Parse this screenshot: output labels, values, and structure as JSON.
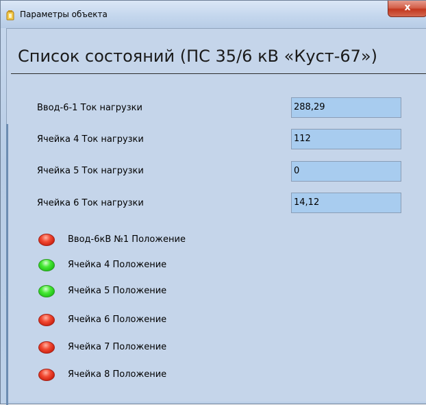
{
  "window": {
    "title": "Параметры объекта",
    "close_label": "x"
  },
  "header": {
    "title": "Список состояний (ПС 35/6 кВ «Куст-67»)"
  },
  "parameters": [
    {
      "label": "Ввод-6-1 Ток нагрузки",
      "value": "288,29"
    },
    {
      "label": "Ячейка 4 Ток нагрузки",
      "value": "112"
    },
    {
      "label": "Ячейка 5 Ток нагрузки",
      "value": "0"
    },
    {
      "label": "Ячейка 6 Ток нагрузки",
      "value": "14,12"
    }
  ],
  "statuses": [
    {
      "label": "Ввод-6кВ №1 Положение",
      "state": "red"
    },
    {
      "label": "Ячейка 4 Положение",
      "state": "green"
    },
    {
      "label": "Ячейка 5 Положение",
      "state": "green"
    },
    {
      "label": "Ячейка 6 Положение",
      "state": "red"
    },
    {
      "label": "Ячейка 7 Положение",
      "state": "red"
    },
    {
      "label": "Ячейка 8 Положение",
      "state": "red"
    }
  ],
  "colors": {
    "status_red": "#e2301c",
    "status_green": "#33d62a",
    "field_background": "#a8ccef",
    "close_button": "#c94530"
  }
}
